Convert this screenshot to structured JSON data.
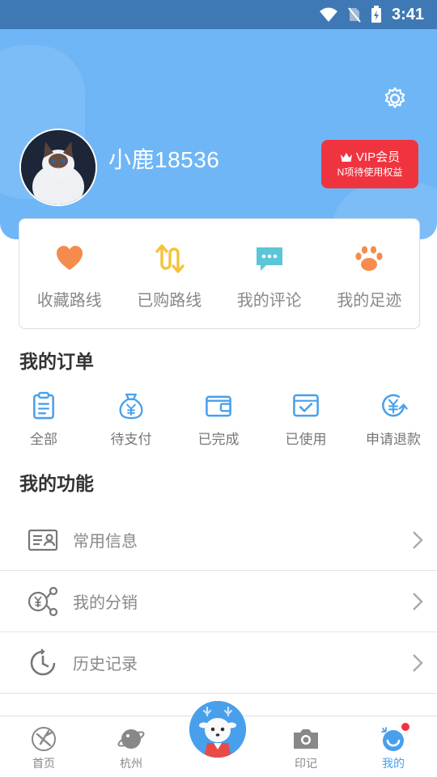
{
  "status_bar": {
    "time": "3:41"
  },
  "profile": {
    "username": "小鹿18536"
  },
  "vip": {
    "title": "VIP会员",
    "subtitle": "N项待使用权益"
  },
  "quick_links": [
    {
      "label": "收藏路线",
      "icon": "heart-icon",
      "color": "#f58b4c"
    },
    {
      "label": "已购路线",
      "icon": "swap-icon",
      "color": "#f5c23a"
    },
    {
      "label": "我的评论",
      "icon": "comment-icon",
      "color": "#5bc6d6"
    },
    {
      "label": "我的足迹",
      "icon": "paw-icon",
      "color": "#f58b4c"
    }
  ],
  "orders": {
    "title": "我的订单",
    "items": [
      {
        "label": "全部",
        "icon": "clipboard-icon"
      },
      {
        "label": "待支付",
        "icon": "money-bag-icon"
      },
      {
        "label": "已完成",
        "icon": "wallet-icon"
      },
      {
        "label": "已使用",
        "icon": "ticket-check-icon"
      },
      {
        "label": "申请退款",
        "icon": "refund-icon"
      }
    ]
  },
  "features": {
    "title": "我的功能",
    "items": [
      {
        "label": "常用信息",
        "icon": "id-card-icon"
      },
      {
        "label": "我的分销",
        "icon": "distribution-icon"
      },
      {
        "label": "历史记录",
        "icon": "history-icon"
      }
    ]
  },
  "tabs": [
    {
      "label": "首页",
      "icon": "home-icon"
    },
    {
      "label": "杭州",
      "icon": "planet-icon"
    },
    {
      "label": "",
      "icon": "deer-mascot-icon"
    },
    {
      "label": "印记",
      "icon": "camera-icon"
    },
    {
      "label": "我的",
      "icon": "profile-icon",
      "active": true
    }
  ],
  "colors": {
    "accent": "#48a0ec",
    "header": "#6fb6f6",
    "vip": "#f0343f"
  }
}
